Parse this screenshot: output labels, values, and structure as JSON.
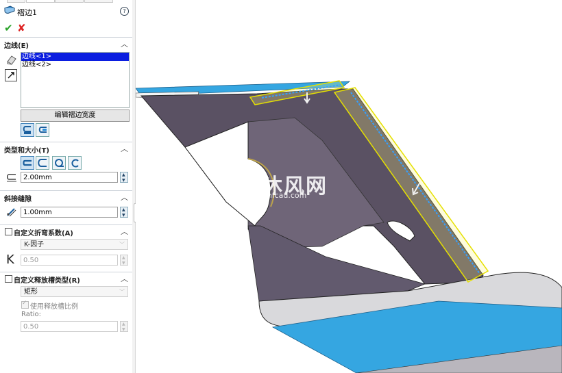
{
  "panel": {
    "title": "褶边1",
    "help": "?",
    "confirm_icon": "✔",
    "cancel_icon": "✘",
    "edges_section": {
      "label": "边线(E)",
      "items": [
        "边线<1>",
        "边线<2>"
      ],
      "edit_button": "编辑褶边宽度"
    },
    "type_section": {
      "label": "类型和大小(T)",
      "length_value": "2.00mm"
    },
    "miter_section": {
      "label": "斜接缝隙",
      "gap_value": "1.00mm"
    },
    "bend_allowance": {
      "label": "自定义折弯系数(A)",
      "checked": false,
      "type_value": "K-因子",
      "k_symbol": "K",
      "k_value": "0.50"
    },
    "relief": {
      "label": "自定义释放槽类型(R)",
      "checked": false,
      "type_value": "矩形",
      "use_ratio_label": "使用释放槽比例",
      "ratio_label": "Ratio:",
      "ratio_value": "0.50"
    }
  },
  "watermark": {
    "text": "沐风网",
    "url": "mfcad.com"
  },
  "colors": {
    "selection": "#0b1ee0",
    "part_face": "#5a5163",
    "part_top": "#34a7e0",
    "highlight": "#f4f000"
  }
}
